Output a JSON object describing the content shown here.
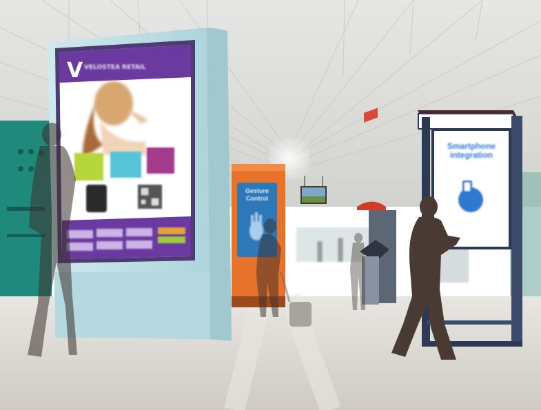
{
  "scene": {
    "description_free": true,
    "colors": {
      "ceiling": "#dcdcda",
      "floor": "#d9d7d2",
      "teal_wall": "#1f8a7c",
      "billboard_frame": "#b9dde4",
      "billboard_screen": "#ffffff",
      "purple": "#6b3aa0",
      "orange_kiosk": "#e7732b",
      "kiosk_screen": "#2f78b7",
      "right_kiosk_frame": "#2d3a55",
      "right_kiosk_screen": "#f7f7f7",
      "right_kiosk_icon": "#2f78d0",
      "silhouette": "#3a2f2b"
    },
    "billboard": {
      "logo_letter": "V",
      "header_text": "VELOSTEA RETAIL"
    },
    "orange_kiosk": {
      "screen_text": "Gesture Control"
    },
    "right_kiosk": {
      "screen_text": "Smartphone integration"
    },
    "icons": {
      "qr": "qr-code-icon",
      "hand": "hand-gesture-icon",
      "phone_link": "phone-link-icon"
    }
  }
}
